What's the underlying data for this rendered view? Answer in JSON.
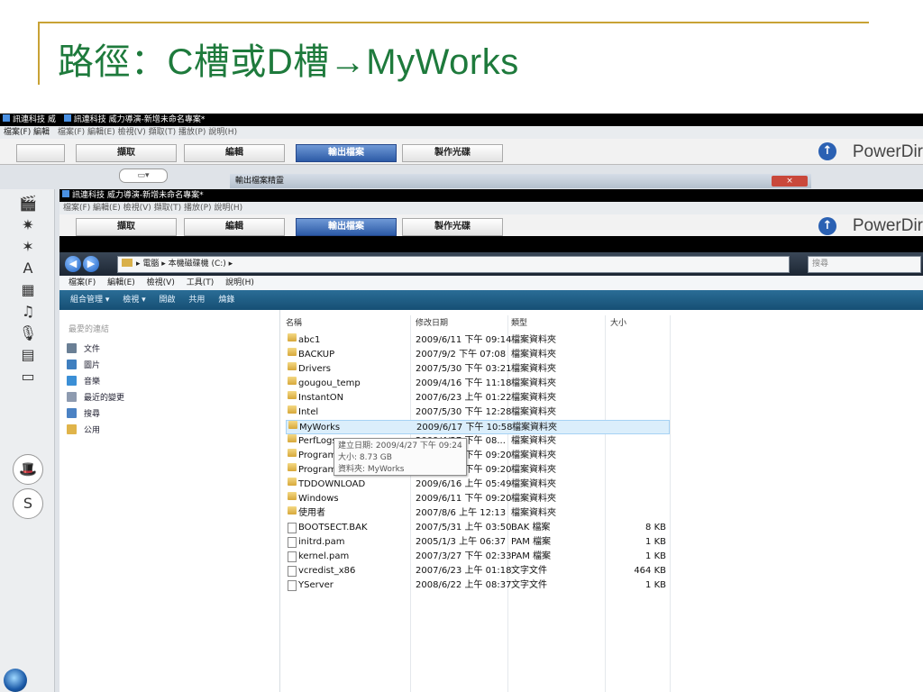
{
  "slide": {
    "title": "路徑：C槽或D槽→MyWorks"
  },
  "back_window": {
    "title1": "訊連科技 威",
    "title2": "訊連科技 威力導演-新增未命名專案*",
    "menu_lead": "檔案(F)  編輯",
    "menu": "檔案(F)  編輯(E)  檢視(V)  擷取(T)  播放(P)  說明(H)",
    "tabs": [
      "擷取",
      "編輯",
      "輸出檔案",
      "製作光碟"
    ],
    "logo": "PowerDir",
    "dialog_title": "輸出檔案精靈",
    "dialog_close": "×"
  },
  "front_window": {
    "title": "訊連科技 威力導演-新增未命名專案*",
    "menu": "檔案(F)  編輯(E)  檢視(V)  擷取(T)  播放(P)  說明(H)",
    "tabs": [
      "擷取",
      "編輯",
      "輸出檔案",
      "製作光碟"
    ],
    "logo": "PowerDir"
  },
  "explorer": {
    "address": "▸ 電腦 ▸ 本機磁碟機 (C:) ▸",
    "search_placeholder": "搜尋",
    "menu": [
      "檔案(F)",
      "編輯(E)",
      "檢視(V)",
      "工具(T)",
      "說明(H)"
    ],
    "toolbar": [
      "組合管理 ▾",
      "檢視 ▾",
      "開啟",
      "共用",
      "燒錄"
    ],
    "nav_header": "最愛的連結",
    "nav_items": [
      {
        "label": "文件",
        "color": "#6a7f95"
      },
      {
        "label": "圖片",
        "color": "#3f7fbf"
      },
      {
        "label": "音樂",
        "color": "#3b8fd6"
      },
      {
        "label": "最近的變更",
        "color": "#8e9bb0"
      },
      {
        "label": "搜尋",
        "color": "#4b82c4"
      },
      {
        "label": "公用",
        "color": "#e0b44a"
      }
    ],
    "columns": [
      "名稱",
      "修改日期",
      "類型",
      "大小"
    ],
    "files": [
      {
        "name": "abc1",
        "date": "2009/6/11 下午 09:14",
        "type": "檔案資料夾",
        "size": "",
        "kind": "folder"
      },
      {
        "name": "BACKUP",
        "date": "2007/9/2 下午 07:08",
        "type": "檔案資料夾",
        "size": "",
        "kind": "folder"
      },
      {
        "name": "Drivers",
        "date": "2007/5/30 下午 03:21",
        "type": "檔案資料夾",
        "size": "",
        "kind": "folder"
      },
      {
        "name": "gougou_temp",
        "date": "2009/4/16 下午 11:18",
        "type": "檔案資料夾",
        "size": "",
        "kind": "folder"
      },
      {
        "name": "InstantON",
        "date": "2007/6/23 上午 01:22",
        "type": "檔案資料夾",
        "size": "",
        "kind": "folder"
      },
      {
        "name": "Intel",
        "date": "2007/5/30 下午 12:28",
        "type": "檔案資料夾",
        "size": "",
        "kind": "folder"
      },
      {
        "name": "MyWorks",
        "date": "2009/6/17 下午 10:58",
        "type": "檔案資料夾",
        "size": "",
        "kind": "folder",
        "selected": true
      },
      {
        "name": "PerfLogs",
        "date": "2009/4/27 下午 08...",
        "type": "檔案資料夾",
        "size": "",
        "kind": "folder"
      },
      {
        "name": "Program",
        "date": "2009/6/11 下午 09:20",
        "type": "檔案資料夾",
        "size": "",
        "kind": "folder"
      },
      {
        "name": "Program",
        "date": "2009/6/11 下午 09:20",
        "type": "檔案資料夾",
        "size": "",
        "kind": "folder"
      },
      {
        "name": "TDDOWNLOAD",
        "date": "2009/6/16 上午 05:49",
        "type": "檔案資料夾",
        "size": "",
        "kind": "folder"
      },
      {
        "name": "Windows",
        "date": "2009/6/11 下午 09:20",
        "type": "檔案資料夾",
        "size": "",
        "kind": "folder"
      },
      {
        "name": "使用者",
        "date": "2007/8/6 上午 12:13",
        "type": "檔案資料夾",
        "size": "",
        "kind": "folder"
      },
      {
        "name": "BOOTSECT.BAK",
        "date": "2007/5/31 上午 03:50",
        "type": "BAK 檔案",
        "size": "8 KB",
        "kind": "file"
      },
      {
        "name": "initrd.pam",
        "date": "2005/1/3 上午 06:37",
        "type": "PAM 檔案",
        "size": "1 KB",
        "kind": "file"
      },
      {
        "name": "kernel.pam",
        "date": "2007/3/27 下午 02:33",
        "type": "PAM 檔案",
        "size": "1 KB",
        "kind": "file"
      },
      {
        "name": "vcredist_x86",
        "date": "2007/6/23 上午 01:18",
        "type": "文字文件",
        "size": "464 KB",
        "kind": "file"
      },
      {
        "name": "YServer",
        "date": "2008/6/22 上午 08:37",
        "type": "文字文件",
        "size": "1 KB",
        "kind": "file"
      }
    ],
    "tooltip": [
      "建立日期: 2009/4/27 下午 09:24",
      "大小: 8.73 GB",
      "資料夾: MyWorks"
    ]
  },
  "colors": {
    "title_green": "#1e7a3c",
    "rule_gold": "#c8a235",
    "selection": "#dbeefb"
  }
}
